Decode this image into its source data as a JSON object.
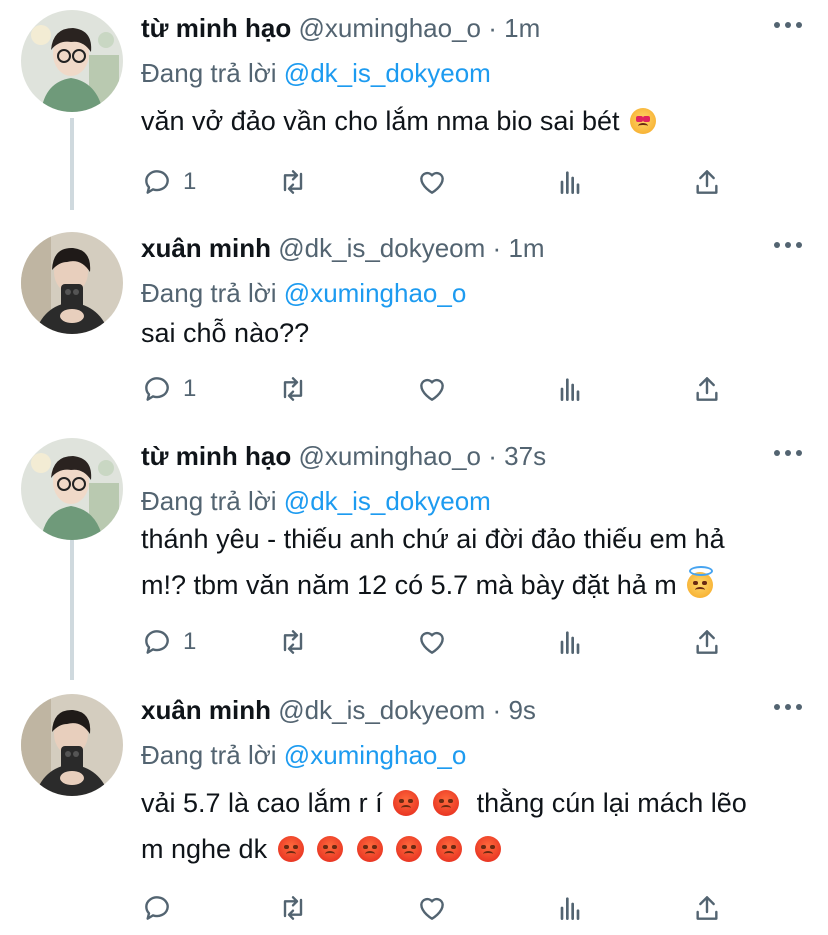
{
  "tweets": [
    {
      "name": "từ minh hạo",
      "handle": "@xuminghao_o",
      "time": "1m",
      "replying_label": "Đang trả lời",
      "replying_to": "@dk_is_dokyeom",
      "text_lines": [
        "văn vở đảo vần cho lắm nma bio sai bét"
      ],
      "reply_count": "1",
      "avatar": "avatar-person-glasses"
    },
    {
      "name": "xuân minh",
      "handle": "@dk_is_dokyeom",
      "time": "1m",
      "replying_label": "Đang trả lời",
      "replying_to": "@xuminghao_o",
      "text_lines": [
        "sai chỗ nào??"
      ],
      "reply_count": "1",
      "avatar": "avatar-person-phone"
    },
    {
      "name": "từ minh hạo",
      "handle": "@xuminghao_o",
      "time": "37s",
      "replying_label": "Đang trả lời",
      "replying_to": "@dk_is_dokyeom",
      "text_lines": [
        "thánh yêu - thiếu anh chứ ai đời đảo thiếu em hả",
        "m!? tbm văn năm 12 có 5.7 mà bày đặt hả m"
      ],
      "reply_count": "1",
      "avatar": "avatar-person-glasses"
    },
    {
      "name": "xuân minh",
      "handle": "@dk_is_dokyeom",
      "time": "9s",
      "replying_label": "Đang trả lời",
      "replying_to": "@xuminghao_o",
      "text_lines": [
        "vải 5.7 là cao lắm r í",
        "thằng cún lại mách lẽo",
        "m nghe dk"
      ],
      "reply_count": "",
      "avatar": "avatar-person-phone"
    }
  ],
  "separator": "·",
  "icons": [
    "reply-icon",
    "retweet-icon",
    "like-icon",
    "analytics-icon",
    "share-icon",
    "more-icon"
  ],
  "colors": {
    "accent": "#1d9bf0",
    "secondary_text": "#536471",
    "thread_line": "#cfd9de"
  }
}
